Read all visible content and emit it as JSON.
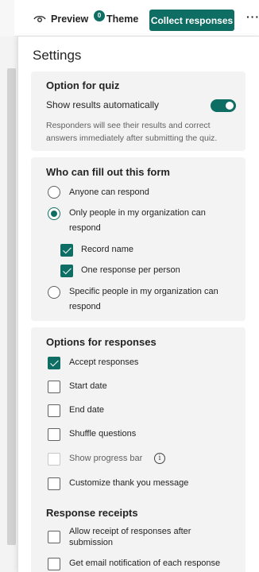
{
  "toolbar": {
    "preview_label": "Preview",
    "theme_label": "Theme",
    "theme_badge": "0",
    "collect_label": "Collect responses",
    "more_label": "···"
  },
  "settings": {
    "title": "Settings",
    "quiz": {
      "title": "Option for quiz",
      "show_results_label": "Show results automatically",
      "show_results_on": true,
      "description_line1": "Responders will see their results and correct",
      "description_line2": "answers immediately after submitting the quiz."
    },
    "who": {
      "title": "Who can fill out this form",
      "anyone": "Anyone can respond",
      "org_line1": "Only people in my organization can",
      "org_line2": "respond",
      "record_name": "Record name",
      "one_response": "One response per person",
      "specific_line1": "Specific people in my organization can",
      "specific_line2": "respond",
      "selected": "org"
    },
    "responses": {
      "title": "Options for responses",
      "accept": "Accept responses",
      "start_date": "Start date",
      "end_date": "End date",
      "shuffle": "Shuffle questions",
      "progress_bar": "Show progress bar",
      "thank_you": "Customize thank you message",
      "info_icon": "i"
    },
    "receipts": {
      "title": "Response receipts",
      "allow_line1": "Allow receipt of responses after",
      "allow_line2": "submission",
      "email_notification": "Get email notification of each response"
    }
  },
  "colors": {
    "accent": "#0f6e64",
    "card_bg": "#f3f3f3"
  }
}
